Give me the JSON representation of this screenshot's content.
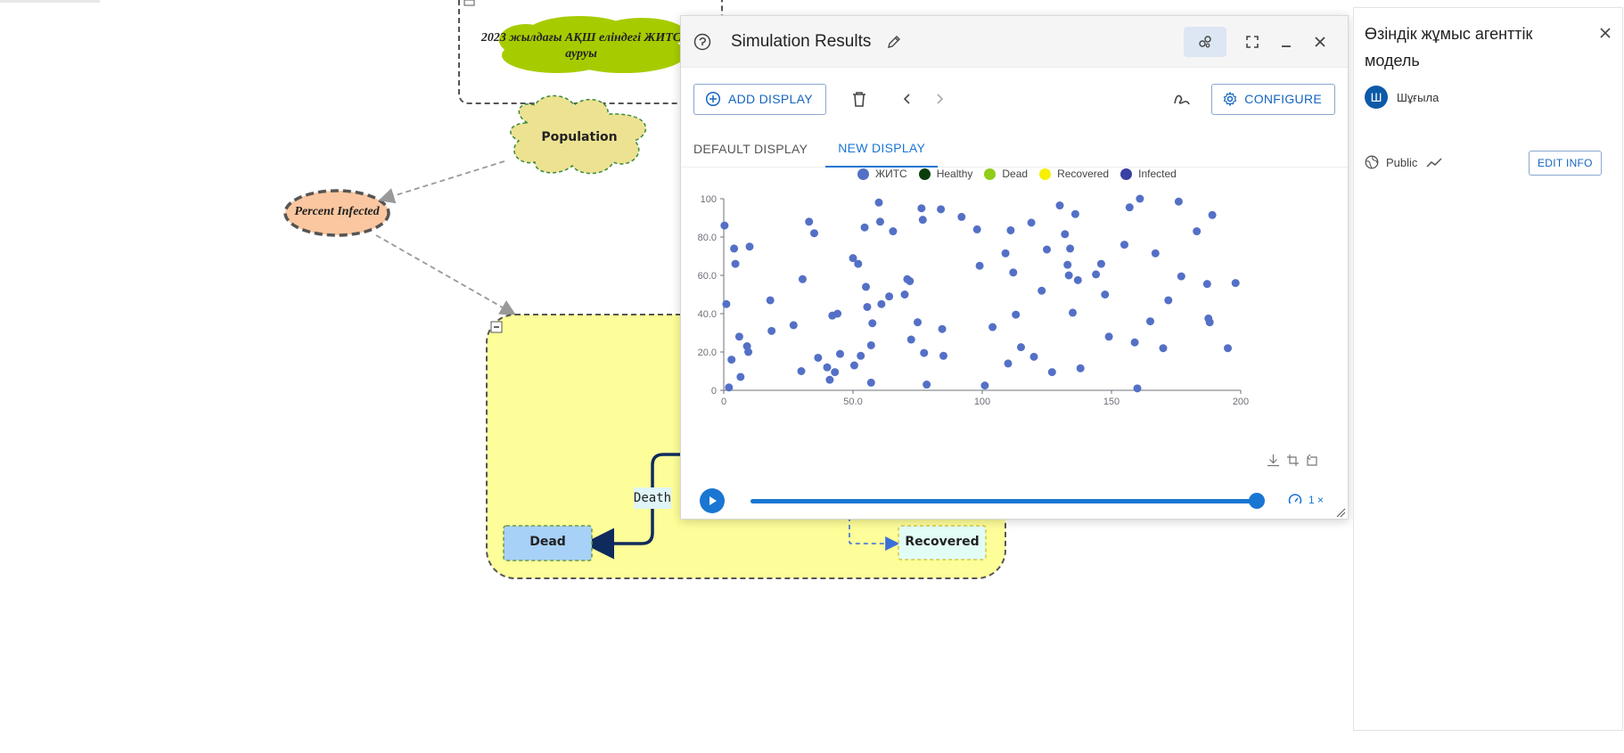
{
  "diagram": {
    "cloud_top_label": "2023 жылдағы АҚШ еліндегі ЖИТС ауруы",
    "population_label": "Population",
    "percent_infected_label": "Percent Infected",
    "death_label": "Death",
    "dead_label": "Dead",
    "recovered_label": "Recovered",
    "collapse_symbol": "−"
  },
  "simulation": {
    "title": "Simulation Results",
    "add_display_label": "ADD DISPLAY",
    "configure_label": "CONFIGURE",
    "tabs": [
      {
        "label": "DEFAULT DISPLAY",
        "active": false
      },
      {
        "label": "NEW DISPLAY",
        "active": true
      }
    ],
    "speed_label": "1 ×",
    "progress": 1.0
  },
  "chart_data": {
    "type": "scatter",
    "series": [
      {
        "name": "ЖИТС",
        "color": "#5470c6"
      },
      {
        "name": "Healthy",
        "color": "#0b3d0b"
      },
      {
        "name": "Dead",
        "color": "#91cc19"
      },
      {
        "name": "Recovered",
        "color": "#f7f000"
      },
      {
        "name": "Infected",
        "color": "#3a3fa3"
      }
    ],
    "xlim": [
      0,
      200
    ],
    "ylim": [
      0,
      100
    ],
    "x_ticks": [
      "0",
      "50.0",
      "100",
      "150",
      "200"
    ],
    "y_ticks": [
      "0",
      "20.0",
      "40.0",
      "60.0",
      "80.0",
      "100"
    ],
    "points": [
      [
        0.3,
        86
      ],
      [
        1,
        45
      ],
      [
        2,
        1.5
      ],
      [
        3,
        16
      ],
      [
        4,
        74
      ],
      [
        4.5,
        66
      ],
      [
        6,
        28
      ],
      [
        6.5,
        7
      ],
      [
        9,
        23
      ],
      [
        9.5,
        20
      ],
      [
        10,
        75
      ],
      [
        18,
        47
      ],
      [
        18.5,
        31
      ],
      [
        27,
        34
      ],
      [
        30,
        10
      ],
      [
        30.5,
        58
      ],
      [
        33,
        88
      ],
      [
        35,
        82
      ],
      [
        36.5,
        17
      ],
      [
        40,
        12
      ],
      [
        41,
        5.5
      ],
      [
        42,
        39
      ],
      [
        43,
        9.5
      ],
      [
        44,
        40
      ],
      [
        45,
        19
      ],
      [
        50,
        69
      ],
      [
        50.5,
        13
      ],
      [
        52,
        66
      ],
      [
        53,
        18
      ],
      [
        54.5,
        85
      ],
      [
        55,
        54
      ],
      [
        55.5,
        43.5
      ],
      [
        57,
        4
      ],
      [
        57,
        23.5
      ],
      [
        57.5,
        35
      ],
      [
        60,
        98
      ],
      [
        60.5,
        88
      ],
      [
        61,
        45
      ],
      [
        64,
        49
      ],
      [
        65.5,
        83
      ],
      [
        70,
        50
      ],
      [
        71,
        58
      ],
      [
        72,
        57
      ],
      [
        72.5,
        26.5
      ],
      [
        75,
        35.5
      ],
      [
        76.5,
        95
      ],
      [
        77,
        89
      ],
      [
        77.5,
        19.5
      ],
      [
        78.5,
        3
      ],
      [
        84,
        94.5
      ],
      [
        84.5,
        32
      ],
      [
        85,
        18
      ],
      [
        92,
        90.5
      ],
      [
        98,
        84
      ],
      [
        99,
        65
      ],
      [
        101,
        2.5
      ],
      [
        104,
        33
      ],
      [
        109,
        71.5
      ],
      [
        110,
        14
      ],
      [
        111,
        83.5
      ],
      [
        112,
        61.5
      ],
      [
        113,
        39.5
      ],
      [
        115,
        22.5
      ],
      [
        119,
        87.5
      ],
      [
        120,
        17.5
      ],
      [
        123,
        52
      ],
      [
        125,
        73.5
      ],
      [
        127,
        9.5
      ],
      [
        130,
        96.5
      ],
      [
        132,
        81.5
      ],
      [
        133,
        65.5
      ],
      [
        133.5,
        60
      ],
      [
        134,
        74
      ],
      [
        135,
        40.5
      ],
      [
        136,
        92
      ],
      [
        137,
        57.5
      ],
      [
        138,
        11.5
      ],
      [
        144,
        60.5
      ],
      [
        146,
        66
      ],
      [
        147.5,
        50
      ],
      [
        149,
        28
      ],
      [
        155,
        76
      ],
      [
        157,
        95.5
      ],
      [
        159,
        25
      ],
      [
        160,
        1
      ],
      [
        161,
        100
      ],
      [
        165,
        36
      ],
      [
        167,
        71.5
      ],
      [
        170,
        22
      ],
      [
        172,
        47
      ],
      [
        176,
        98.5
      ],
      [
        177,
        59.5
      ],
      [
        183,
        83
      ],
      [
        187,
        55.5
      ],
      [
        187.5,
        37.5
      ],
      [
        188,
        35.5
      ],
      [
        189,
        91.5
      ],
      [
        195,
        22
      ],
      [
        198,
        56
      ]
    ]
  },
  "info": {
    "title": "Өзіндік жұмыс агенттік модель",
    "avatar_letter": "Ш",
    "author": "Шұғыла",
    "visibility": "Public",
    "edit_info_label": "EDIT INFO"
  }
}
